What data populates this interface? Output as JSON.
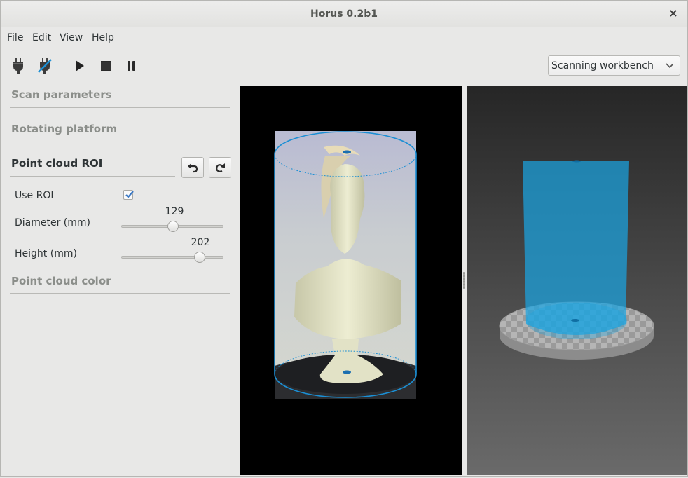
{
  "window": {
    "title": "Horus 0.2b1",
    "close_glyph": "×"
  },
  "menu": [
    "File",
    "Edit",
    "View",
    "Help"
  ],
  "toolbar": {
    "tools": [
      {
        "name": "connect-icon"
      },
      {
        "name": "disconnect-icon"
      },
      {
        "name": "play-icon"
      },
      {
        "name": "stop-icon"
      },
      {
        "name": "pause-icon"
      }
    ],
    "workbench": {
      "selected": "Scanning workbench"
    }
  },
  "panel": {
    "sections": {
      "scan_parameters": "Scan parameters",
      "rotating_platform": "Rotating platform",
      "point_cloud_roi": "Point cloud ROI",
      "point_cloud_color": "Point cloud color"
    },
    "roi": {
      "use_roi_label": "Use ROI",
      "use_roi_checked": true,
      "diameter_label": "Diameter (mm)",
      "diameter_value": "129",
      "diameter_fraction": 0.51,
      "height_label": "Height (mm)",
      "height_value": "202",
      "height_fraction": 0.77
    }
  },
  "colors": {
    "accent": "#4a90d9",
    "roi_blue": "#1b8fd4",
    "platform": "#b9b9b9"
  }
}
